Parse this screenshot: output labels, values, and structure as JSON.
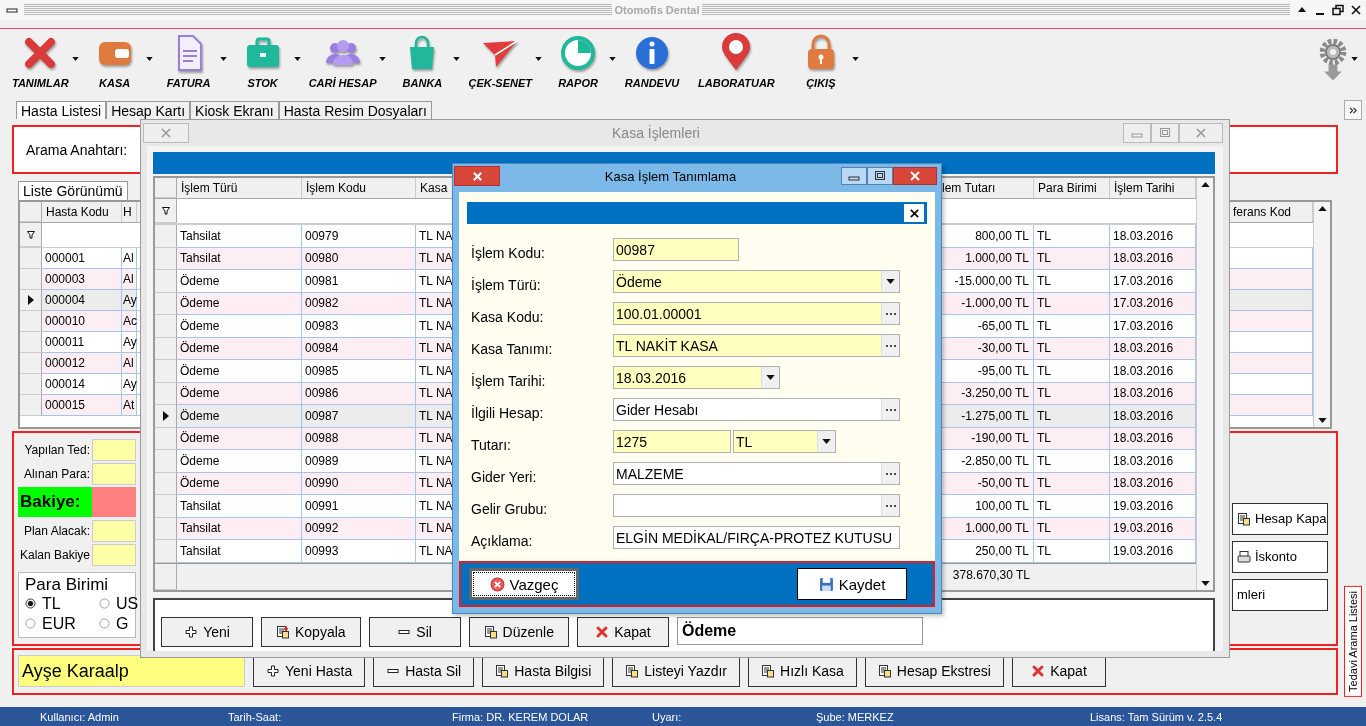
{
  "app": {
    "title": "Otomofis Dental"
  },
  "toolbar": [
    {
      "label": "TANIMLAR",
      "kind": "tools",
      "dropdown": true
    },
    {
      "label": "KASA",
      "kind": "wallet",
      "dropdown": true
    },
    {
      "label": "FATURA",
      "kind": "document",
      "dropdown": true
    },
    {
      "label": "STOK",
      "kind": "briefcase",
      "dropdown": true
    },
    {
      "label": "CARİ HESAP",
      "kind": "users",
      "dropdown": true
    },
    {
      "label": "BANKA",
      "kind": "bag",
      "dropdown": true
    },
    {
      "label": "ÇEK-SENET",
      "kind": "plane",
      "dropdown": true
    },
    {
      "label": "RAPOR",
      "kind": "pie",
      "dropdown": true
    },
    {
      "label": "RANDEVU",
      "kind": "info",
      "dropdown": false
    },
    {
      "label": "LABORATUAR",
      "kind": "pin",
      "dropdown": false
    },
    {
      "label": "ÇIKIŞ",
      "kind": "lock",
      "dropdown": true
    }
  ],
  "tabs": [
    {
      "label": "Hasta Listesi",
      "selected": true
    },
    {
      "label": "Hesap Kartı",
      "selected": false
    },
    {
      "label": "Kiosk Ekranı",
      "selected": false
    },
    {
      "label": "Hasta Resim Dosyaları",
      "selected": false
    }
  ],
  "search": {
    "label": "Arama Anahtarı:"
  },
  "view_tabs": [
    {
      "label": "Liste Görünümü",
      "selected": true
    }
  ],
  "patients": {
    "columns": [
      "Hasta Kodu",
      "H",
      "ferans Kod"
    ],
    "rows": [
      {
        "code": "000001",
        "name": "Al",
        "selected": false
      },
      {
        "code": "000003",
        "name": "Al",
        "selected": false
      },
      {
        "code": "000004",
        "name": "Ay",
        "selected": true
      },
      {
        "code": "000010",
        "name": "Ac",
        "selected": false
      },
      {
        "code": "000011",
        "name": "Ay",
        "selected": false
      },
      {
        "code": "000012",
        "name": "Al",
        "selected": false
      },
      {
        "code": "000014",
        "name": "Ay",
        "selected": false
      },
      {
        "code": "000015",
        "name": "At",
        "selected": false
      }
    ]
  },
  "summary": {
    "fields": [
      {
        "label": "Yapılan Ted:",
        "kind": "plain"
      },
      {
        "label": "Alınan Para:",
        "kind": "plain"
      },
      {
        "label": "Bakiye:",
        "kind": "balance"
      },
      {
        "label": "Plan Alacak:",
        "kind": "plain"
      },
      {
        "label": "Kalan Bakiye",
        "kind": "plain"
      }
    ],
    "currency": {
      "title": "Para Birimi",
      "options": [
        {
          "label": "TL",
          "selected": true
        },
        {
          "label": "US",
          "selected": false
        },
        {
          "label": "EUR",
          "selected": false
        },
        {
          "label": "G",
          "selected": false
        }
      ]
    }
  },
  "side_buttons": [
    {
      "label": "Hesap Kapa",
      "kind": "document"
    },
    {
      "label": "İskonto",
      "kind": "print"
    },
    {
      "label": "mleri",
      "kind": "plain"
    }
  ],
  "side_panel": {
    "title": "Tedavi Arama Listesi"
  },
  "patient_name": "Ayşe Karaalp",
  "bottom_buttons": [
    {
      "label": "Yeni Hasta",
      "kind": "add"
    },
    {
      "label": "Hasta Sil",
      "kind": "remove"
    },
    {
      "label": "Hasta Bilgisi",
      "kind": "document"
    },
    {
      "label": "Listeyi Yazdır",
      "kind": "document"
    },
    {
      "label": "Hızlı Kasa",
      "kind": "document"
    },
    {
      "label": "Hesap Ekstresi",
      "kind": "document"
    },
    {
      "label": "Kapat",
      "kind": "close"
    }
  ],
  "status_bar": [
    "Kullanıcı: Admin",
    "Tarih-Saat:",
    "Firma: DR. KEREM DOLAR",
    "Uyarı:",
    "Şube: MERKEZ",
    "Lisans: Tam Sürüm v. 2.5.4"
  ],
  "kasa_window": {
    "title": "Kasa İşlemleri",
    "columns": [
      "İşlem Türü",
      "İşlem Kodu",
      "Kasa",
      "lem Tutarı",
      "Para Birimi",
      "İşlem Tarihi"
    ],
    "rows": [
      {
        "type": "Tahsilat",
        "code": "00979",
        "kasa": "TL NA",
        "amount": "800,00 TL",
        "currency": "TL",
        "date": "18.03.2016",
        "selected": false
      },
      {
        "type": "Tahsilat",
        "code": "00980",
        "kasa": "TL NA",
        "amount": "1.000,00 TL",
        "currency": "TL",
        "date": "18.03.2016",
        "selected": false
      },
      {
        "type": "Ödeme",
        "code": "00981",
        "kasa": "TL NA",
        "amount": "-15.000,00 TL",
        "currency": "TL",
        "date": "17.03.2016",
        "selected": false
      },
      {
        "type": "Ödeme",
        "code": "00982",
        "kasa": "TL NA",
        "amount": "-1.000,00 TL",
        "currency": "TL",
        "date": "17.03.2016",
        "selected": false
      },
      {
        "type": "Ödeme",
        "code": "00983",
        "kasa": "TL NA",
        "amount": "-65,00 TL",
        "currency": "TL",
        "date": "17.03.2016",
        "selected": false
      },
      {
        "type": "Ödeme",
        "code": "00984",
        "kasa": "TL NA",
        "amount": "-30,00 TL",
        "currency": "TL",
        "date": "18.03.2016",
        "selected": false
      },
      {
        "type": "Ödeme",
        "code": "00985",
        "kasa": "TL NA",
        "amount": "-95,00 TL",
        "currency": "TL",
        "date": "18.03.2016",
        "selected": false
      },
      {
        "type": "Ödeme",
        "code": "00986",
        "kasa": "TL NA",
        "amount": "-3.250,00 TL",
        "currency": "TL",
        "date": "18.03.2016",
        "selected": false
      },
      {
        "type": "Ödeme",
        "code": "00987",
        "kasa": "TL NA",
        "amount": "-1.275,00 TL",
        "currency": "TL",
        "date": "18.03.2016",
        "selected": true
      },
      {
        "type": "Ödeme",
        "code": "00988",
        "kasa": "TL NA",
        "amount": "-190,00 TL",
        "currency": "TL",
        "date": "18.03.2016",
        "selected": false
      },
      {
        "type": "Ödeme",
        "code": "00989",
        "kasa": "TL NA",
        "amount": "-2.850,00 TL",
        "currency": "TL",
        "date": "18.03.2016",
        "selected": false
      },
      {
        "type": "Ödeme",
        "code": "00990",
        "kasa": "TL NA",
        "amount": "-50,00 TL",
        "currency": "TL",
        "date": "18.03.2016",
        "selected": false
      },
      {
        "type": "Tahsilat",
        "code": "00991",
        "kasa": "TL NA",
        "amount": "100,00 TL",
        "currency": "TL",
        "date": "19.03.2016",
        "selected": false
      },
      {
        "type": "Tahsilat",
        "code": "00992",
        "kasa": "TL NA",
        "amount": "1.000,00 TL",
        "currency": "TL",
        "date": "19.03.2016",
        "selected": false
      },
      {
        "type": "Tahsilat",
        "code": "00993",
        "kasa": "TL NA",
        "amount": "250,00 TL",
        "currency": "TL",
        "date": "19.03.2016",
        "selected": false
      }
    ],
    "total": "378.670,30 TL",
    "buttons": [
      {
        "label": "Yeni",
        "kind": "add"
      },
      {
        "label": "Kopyala",
        "kind": "copy"
      },
      {
        "label": "Sil",
        "kind": "remove"
      },
      {
        "label": "Düzenle",
        "kind": "document"
      },
      {
        "label": "Kapat",
        "kind": "close"
      }
    ],
    "filter_value": "Ödeme"
  },
  "dialog": {
    "title": "Kasa İşlem Tanımlama",
    "fields": [
      {
        "label": "İşlem Kodu:",
        "kind": "short",
        "value": "00987",
        "required": true
      },
      {
        "label": "İşlem Türü:",
        "kind": "combo",
        "value": "Ödeme",
        "required": true
      },
      {
        "label": "Kasa Kodu:",
        "kind": "lookup",
        "value": "100.01.00001",
        "required": true
      },
      {
        "label": "Kasa Tanımı:",
        "kind": "lookup",
        "value": "TL NAKİT KASA",
        "required": true
      },
      {
        "label": "İşlem Tarihi:",
        "kind": "date",
        "value": "18.03.2016",
        "required": true
      },
      {
        "label": "İlgili Hesap:",
        "kind": "lookup",
        "value": "Gider Hesabı",
        "required": false
      },
      {
        "label": "Tutarı:",
        "kind": "amount",
        "value": "1275",
        "currency": "TL",
        "required": true
      },
      {
        "label": "Gider Yeri:",
        "kind": "lookup",
        "value": "MALZEME",
        "required": false
      },
      {
        "label": "Gelir Grubu:",
        "kind": "lookup",
        "required": false
      },
      {
        "label": "Açıklama:",
        "kind": "text",
        "value": "ELGİN MEDİKAL/FIRÇA-PROTEZ KUTUSU",
        "required": false
      }
    ],
    "buttons": [
      {
        "label": "Vazgeç",
        "kind": "cancel",
        "focused": true
      },
      {
        "label": "Kaydet",
        "kind": "save",
        "focused": false
      }
    ]
  }
}
